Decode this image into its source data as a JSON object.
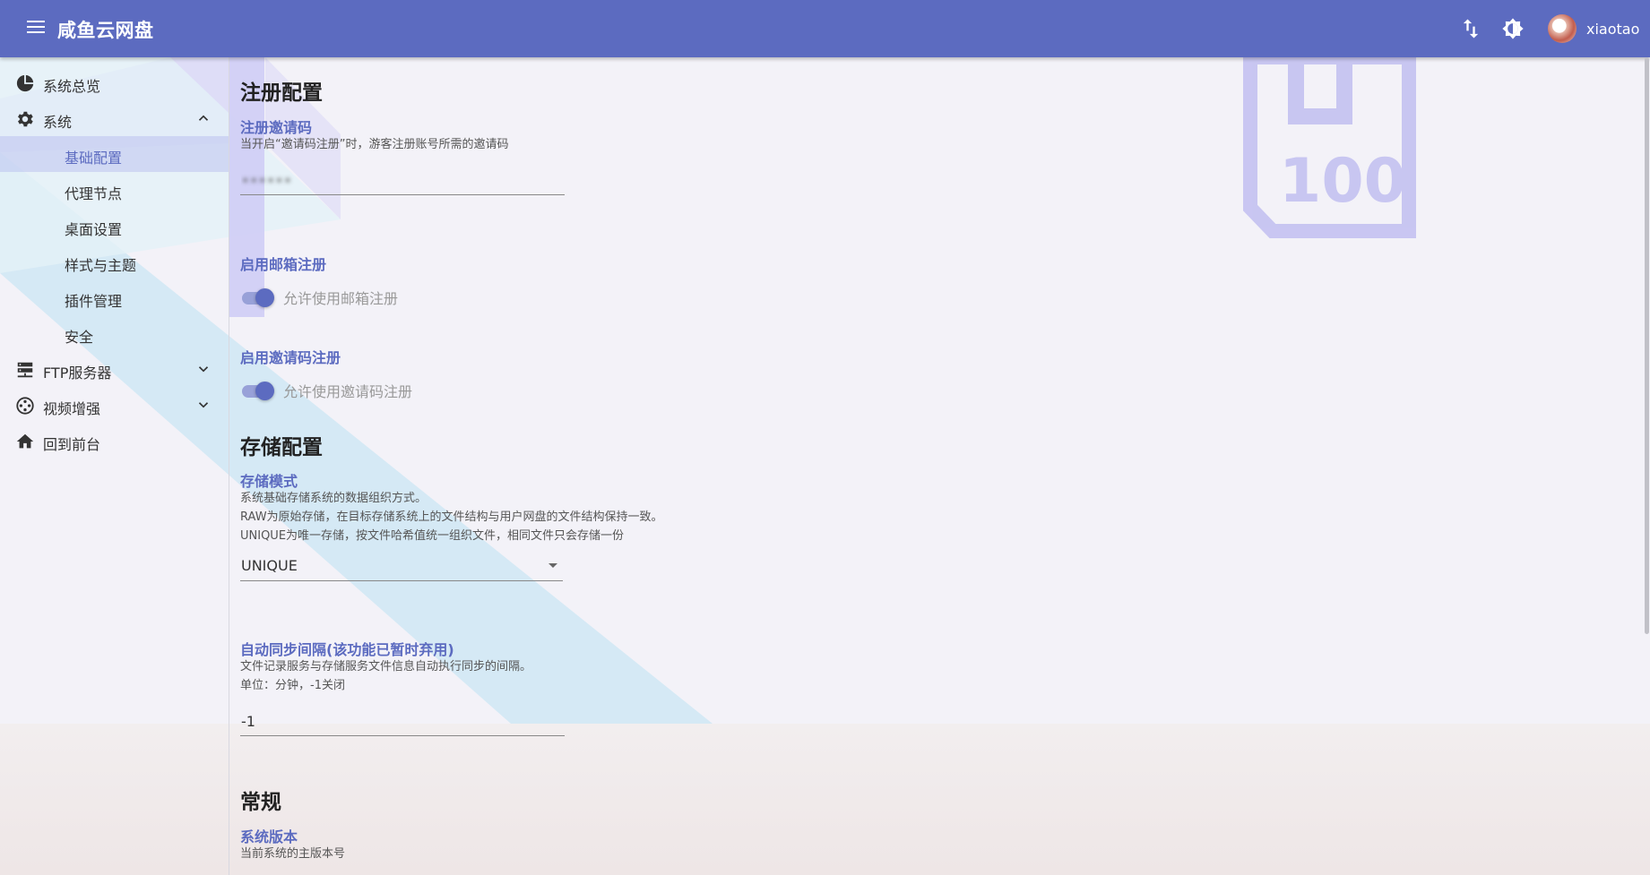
{
  "app": {
    "title": "咸鱼云网盘"
  },
  "header": {
    "menu_icon": "menu-icon",
    "transfer_icon": "swap-vertical-icon",
    "theme_icon": "brightness-icon",
    "username": "xiaotao"
  },
  "sidebar": {
    "items": [
      {
        "label": "系统总览",
        "icon": "dashboard-pie-icon"
      },
      {
        "label": "系统",
        "icon": "gear-icon",
        "expanded": true
      },
      {
        "label": "FTP服务器",
        "icon": "server-icon",
        "expanded": false
      },
      {
        "label": "视频增强",
        "icon": "film-reel-icon",
        "expanded": false
      },
      {
        "label": "回到前台",
        "icon": "home-icon"
      }
    ],
    "system_children": [
      {
        "label": "基础配置",
        "active": true
      },
      {
        "label": "代理节点"
      },
      {
        "label": "桌面设置"
      },
      {
        "label": "样式与主题"
      },
      {
        "label": "插件管理"
      },
      {
        "label": "安全"
      }
    ]
  },
  "main": {
    "register_section": {
      "title": "注册配置",
      "invite_code": {
        "label": "注册邀请码",
        "helper": "当开启“邀请码注册”时，游客注册账号所需的邀请码",
        "value": "••••••"
      },
      "email_register": {
        "label": "启用邮箱注册",
        "switch_text": "允许使用邮箱注册",
        "enabled": true
      },
      "invite_register": {
        "label": "启用邀请码注册",
        "switch_text": "允许使用邀请码注册",
        "enabled": true
      }
    },
    "storage_section": {
      "title": "存储配置",
      "mode": {
        "label": "存储模式",
        "helper_lines": [
          "系统基础存储系统的数据组织方式。",
          "RAW为原始存储，在目标存储系统上的文件结构与用户网盘的文件结构保持一致。",
          "UNIQUE为唯一存储，按文件哈希值统一组织文件，相同文件只会存储一份"
        ],
        "value": "UNIQUE"
      },
      "sync_interval": {
        "label": "自动同步间隔(该功能已暂时弃用)",
        "helper_lines": [
          "文件记录服务与存储服务文件信息自动执行同步的间隔。",
          "单位：分钟，-1关闭"
        ],
        "value": "-1"
      }
    },
    "general_section": {
      "title": "常规",
      "version": {
        "label": "系统版本",
        "helper": "当前系统的主版本号"
      }
    }
  },
  "colors": {
    "primary": "#5c6bc0",
    "appbar": "#5c6bc0",
    "background": "#f3f2f8"
  }
}
